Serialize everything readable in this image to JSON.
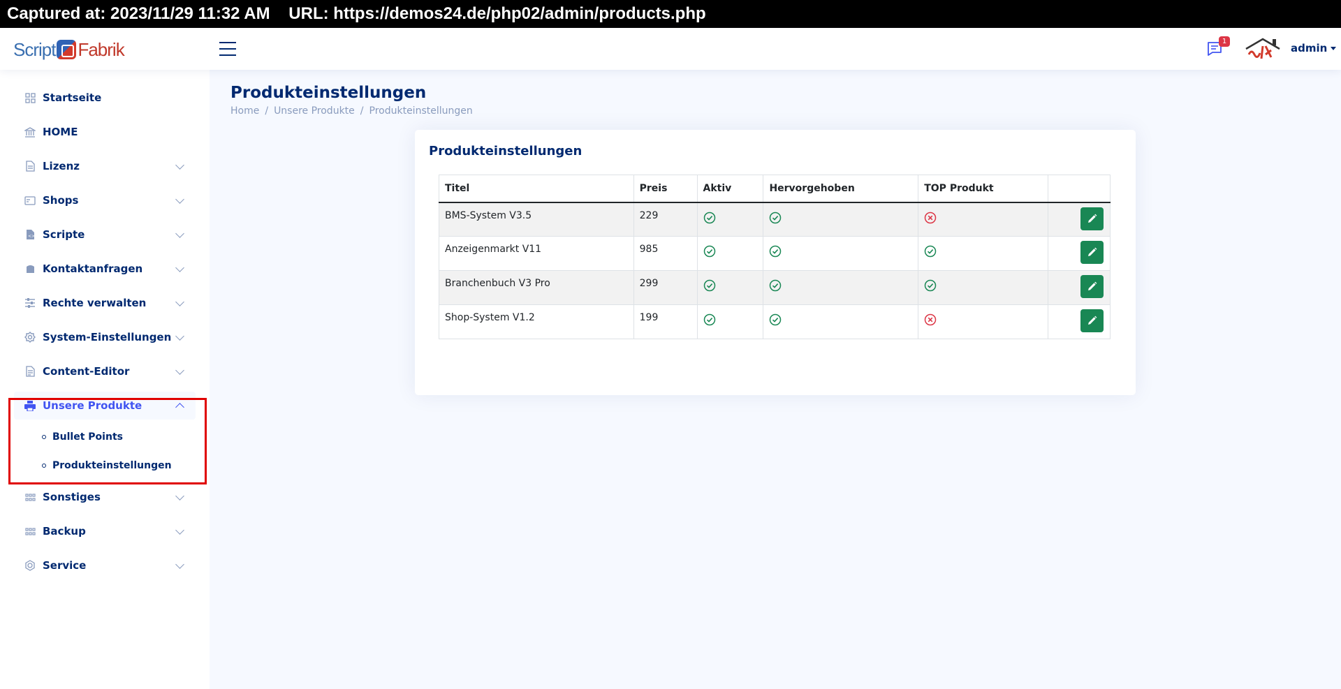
{
  "capture": {
    "text": "Captured at: 2023/11/29 11:32 AM    URL: https://demos24.de/php02/admin/products.php"
  },
  "header": {
    "logo_left": "Script",
    "logo_right": "Fabrik",
    "notification_count": "1",
    "user_name": "admin"
  },
  "sidebar": {
    "items": [
      {
        "label": "Startseite",
        "icon": "grid-icon",
        "has_children": false
      },
      {
        "label": "HOME",
        "icon": "bank-icon",
        "has_children": false
      },
      {
        "label": "Lizenz",
        "icon": "document-icon",
        "has_children": true
      },
      {
        "label": "Shops",
        "icon": "card-icon",
        "has_children": true
      },
      {
        "label": "Scripte",
        "icon": "file-code-icon",
        "has_children": true
      },
      {
        "label": "Kontaktanfragen",
        "icon": "inbox-icon",
        "has_children": true
      },
      {
        "label": "Rechte verwalten",
        "icon": "sliders-icon",
        "has_children": true
      },
      {
        "label": "System-Einstellungen",
        "icon": "gear-icon",
        "has_children": true
      },
      {
        "label": "Content-Editor",
        "icon": "file-text-icon",
        "has_children": true
      },
      {
        "label": "Unsere Produkte",
        "icon": "printer-icon",
        "has_children": true,
        "active": true
      },
      {
        "label": "Sonstiges",
        "icon": "apps-icon",
        "has_children": true
      },
      {
        "label": "Backup",
        "icon": "apps-icon",
        "has_children": true
      },
      {
        "label": "Service",
        "icon": "service-icon",
        "has_children": true
      }
    ],
    "sub_items": [
      {
        "label": "Bullet Points"
      },
      {
        "label": "Produkteinstellungen"
      }
    ]
  },
  "page": {
    "title": "Produkteinstellungen",
    "breadcrumb": [
      "Home",
      "Unsere Produkte",
      "Produkteinstellungen"
    ]
  },
  "card": {
    "title": "Produkteinstellungen",
    "columns": [
      "Titel",
      "Preis",
      "Aktiv",
      "Hervorgehoben",
      "TOP Produkt",
      ""
    ],
    "rows": [
      {
        "titel": "BMS-System V3.5",
        "preis": "229",
        "aktiv": true,
        "hervorgehoben": true,
        "top": false
      },
      {
        "titel": "Anzeigenmarkt V11",
        "preis": "985",
        "aktiv": true,
        "hervorgehoben": true,
        "top": true
      },
      {
        "titel": "Branchenbuch V3 Pro",
        "preis": "299",
        "aktiv": true,
        "hervorgehoben": true,
        "top": true
      },
      {
        "titel": "Shop-System V1.2",
        "preis": "199",
        "aktiv": true,
        "hervorgehoben": true,
        "top": false
      }
    ]
  },
  "colors": {
    "primary": "#012970",
    "accent": "#4154f1",
    "success": "#198754",
    "danger": "#dc3545",
    "highlight": "#e00000"
  }
}
